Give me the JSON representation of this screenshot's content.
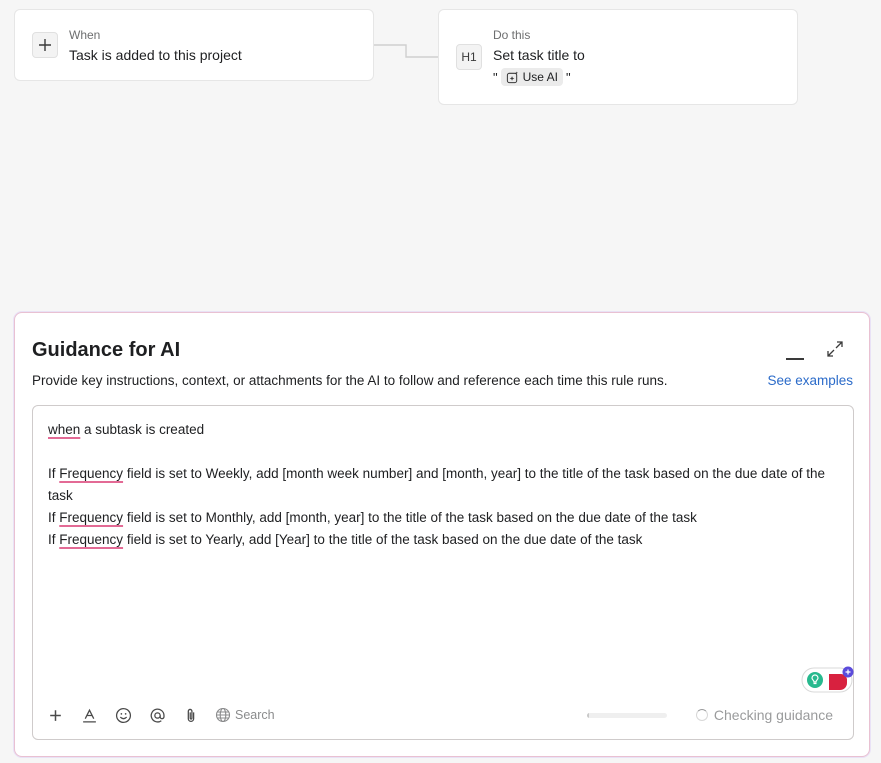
{
  "trigger": {
    "kicker": "When",
    "text": "Task is added to this project",
    "icon": "plus-icon"
  },
  "action": {
    "kicker": "Do this",
    "text": "Set task title to",
    "icon": "heading-icon",
    "icon_text": "H1",
    "quote_open": "\"",
    "quote_close": "\"",
    "chip_label": "Use AI"
  },
  "panel": {
    "title": "Guidance for AI",
    "description": "Provide key instructions, context, or attachments for the AI to follow and reference each time this rule runs.",
    "see_examples": "See examples"
  },
  "editor": {
    "line1_word": "when",
    "line1_rest": " a subtask is created",
    "lines": [
      {
        "pre": "If ",
        "word": "Frequency",
        "post": " field is set to Weekly, add [month week number] and [month, year] to the title of the task based on the due date of the task"
      },
      {
        "pre": "If ",
        "word": "Frequency",
        "post": " field is set to Monthly, add [month, year] to the title of the task based on the due date of the task"
      },
      {
        "pre": "If ",
        "word": "Frequency",
        "post": " field is set to Yearly, add [Year] to the title of the task based on the due date of the task"
      }
    ]
  },
  "toolbar": {
    "search_label": "Search",
    "items": [
      "plus-icon",
      "text-format-icon",
      "emoji-icon",
      "mention-icon",
      "attach-icon",
      "globe-icon"
    ]
  },
  "status": {
    "label": "Checking guidance",
    "progress_fraction": 0.02
  },
  "colors": {
    "link": "#2b6bc9",
    "squiggle": "#e36a95",
    "panel_border": "#e9c1d2"
  }
}
